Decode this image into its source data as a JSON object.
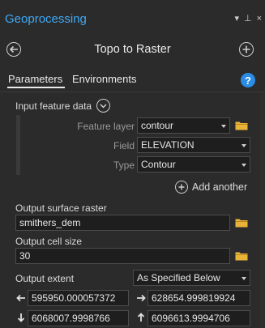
{
  "window": {
    "title": "Geoprocessing",
    "controls": [
      "▾",
      "⊥",
      "×"
    ]
  },
  "tool": {
    "title": "Topo to Raster",
    "back_icon": "back-arrow-icon",
    "add_icon": "plus-circle-icon"
  },
  "tabs": {
    "parameters": "Parameters",
    "environments": "Environments",
    "help": "?"
  },
  "input_feature": {
    "label": "Input feature data",
    "feature_layer_label": "Feature layer",
    "feature_layer_value": "contour",
    "field_label": "Field",
    "field_value": "ELEVATION",
    "type_label": "Type",
    "type_value": "Contour",
    "add_another": "Add another"
  },
  "output_raster": {
    "label": "Output surface raster",
    "value": "smithers_dem"
  },
  "cell_size": {
    "label": "Output cell size",
    "value": "30"
  },
  "extent": {
    "label": "Output extent",
    "mode": "As Specified Below",
    "left": "595950.000057372",
    "right": "628654.999819924",
    "bottom": "6068007.9998766",
    "top": "6096613.9994706"
  },
  "colors": {
    "accent": "#3fa9f5",
    "help": "#2b8ce6",
    "background": "#2b2b2b",
    "input_bg": "#1e1e1e",
    "folder": "#e8b339"
  }
}
